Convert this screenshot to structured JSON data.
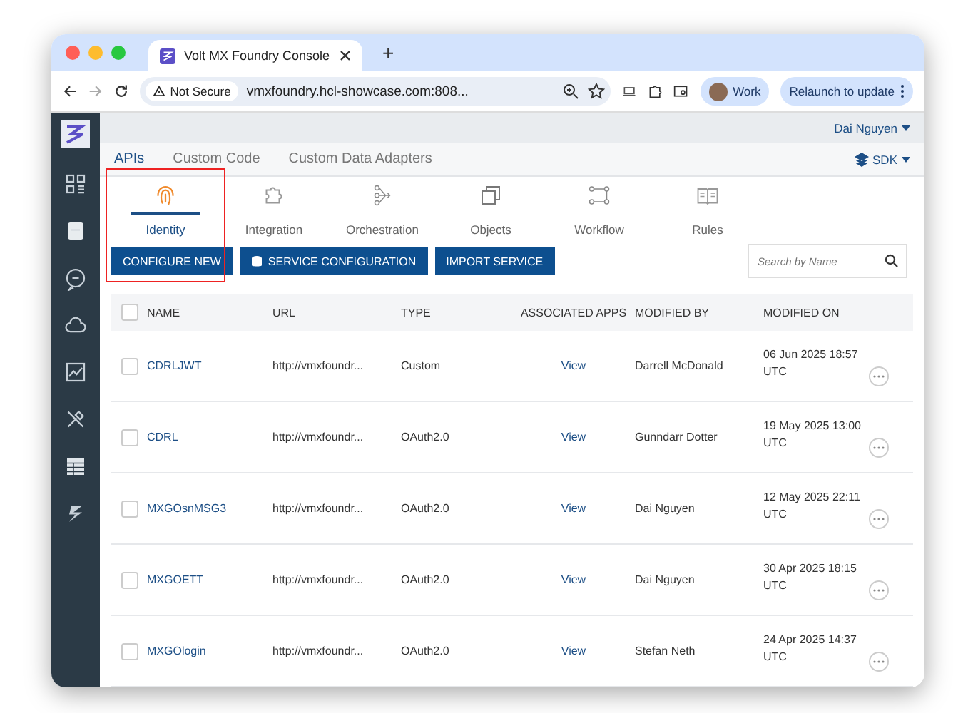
{
  "browser": {
    "tab_title": "Volt MX Foundry Console",
    "new_tab": "+",
    "security": "Not Secure",
    "address": "vmxfoundry.hcl-showcase.com:808...",
    "profile": "Work",
    "relaunch": "Relaunch to update"
  },
  "user_menu": {
    "label": "Dai Nguyen"
  },
  "tabs": [
    {
      "label": "APIs",
      "selected": true
    },
    {
      "label": "Custom Code",
      "selected": false
    },
    {
      "label": "Custom Data Adapters",
      "selected": false
    }
  ],
  "sdk_menu": {
    "label": "SDK"
  },
  "service_tabs": [
    {
      "label": "Identity",
      "selected": true
    },
    {
      "label": "Integration",
      "selected": false
    },
    {
      "label": "Orchestration",
      "selected": false
    },
    {
      "label": "Objects",
      "selected": false
    },
    {
      "label": "Workflow",
      "selected": false
    },
    {
      "label": "Rules",
      "selected": false
    }
  ],
  "actions": [
    "CONFIGURE NEW",
    "SERVICE CONFIGURATION",
    "IMPORT SERVICE"
  ],
  "search": {
    "placeholder": "Search by Name"
  },
  "table": {
    "select_all": {
      "checked": false
    },
    "columns": [
      "NAME",
      "URL",
      "TYPE",
      "ASSOCIATED APPS",
      "MODIFIED BY",
      "MODIFIED ON"
    ],
    "rows": [
      {
        "checked": false,
        "name": "CDRLJWT",
        "url": "http://vmxfoundr...",
        "type": "Custom",
        "apps": "View",
        "modified_by": "Darrell McDonald",
        "modified_on": "06 Jun 2025 18:57 UTC"
      },
      {
        "checked": false,
        "name": "CDRL",
        "url": "http://vmxfoundr...",
        "type": "OAuth2.0",
        "apps": "View",
        "modified_by": "Gunndarr Dotter",
        "modified_on": "19 May 2025 13:00 UTC"
      },
      {
        "checked": false,
        "name": "MXGOsnMSG3",
        "url": "http://vmxfoundr...",
        "type": "OAuth2.0",
        "apps": "View",
        "modified_by": "Dai Nguyen",
        "modified_on": "12 May 2025 22:11 UTC"
      },
      {
        "checked": false,
        "name": "MXGOETT",
        "url": "http://vmxfoundr...",
        "type": "OAuth2.0",
        "apps": "View",
        "modified_by": "Dai Nguyen",
        "modified_on": "30 Apr 2025 18:15 UTC"
      },
      {
        "checked": false,
        "name": "MXGOlogin",
        "url": "http://vmxfoundr...",
        "type": "OAuth2.0",
        "apps": "View",
        "modified_by": "Stefan Neth",
        "modified_on": "24 Apr 2025 14:37 UTC"
      }
    ]
  }
}
